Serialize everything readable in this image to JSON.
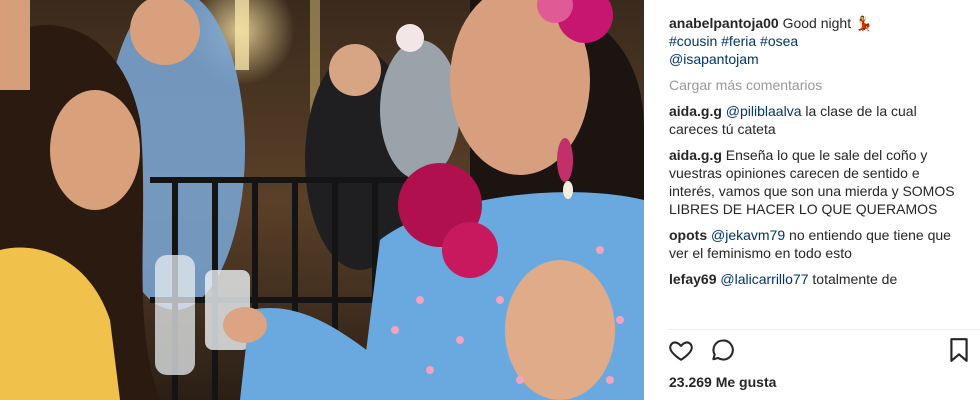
{
  "post": {
    "photo_alt": "Photo",
    "caption": {
      "username": "anabelpantoja00",
      "text": "Good night",
      "emoji": "💃",
      "hashtags": "#cousin #feria #osea",
      "mention": "@isapantojam"
    },
    "load_more": "Cargar más comentarios",
    "comments": [
      {
        "username": "aida.g.g",
        "mention": "@pilibla​alva",
        "text": "la clase de la cual careces tú cateta"
      },
      {
        "username": "aida.g.g",
        "mention": "",
        "text": "Enseña lo que le sale del coño y vuestras opiniones carecen de sentido e interés, vamos que son una mierda y SOMOS LIBRES DE HACER LO QUE QUERAMOS"
      },
      {
        "username": "opots",
        "mention": "@jekavm79",
        "text": "no entiendo que tiene que ver el feminismo en todo esto"
      },
      {
        "username": "lefay69",
        "mention": "@lalicarrillo77",
        "text": "totalmente de"
      }
    ],
    "actions": {
      "like_icon": "heart-icon",
      "comment_icon": "comment-bubble-icon",
      "save_icon": "bookmark-icon"
    },
    "likes": "23.269 Me gusta"
  },
  "colors": {
    "link": "#003569",
    "muted": "#999999",
    "text": "#262626",
    "dress_blue": "#6aa9e0",
    "flower_magenta": "#b0104e"
  }
}
